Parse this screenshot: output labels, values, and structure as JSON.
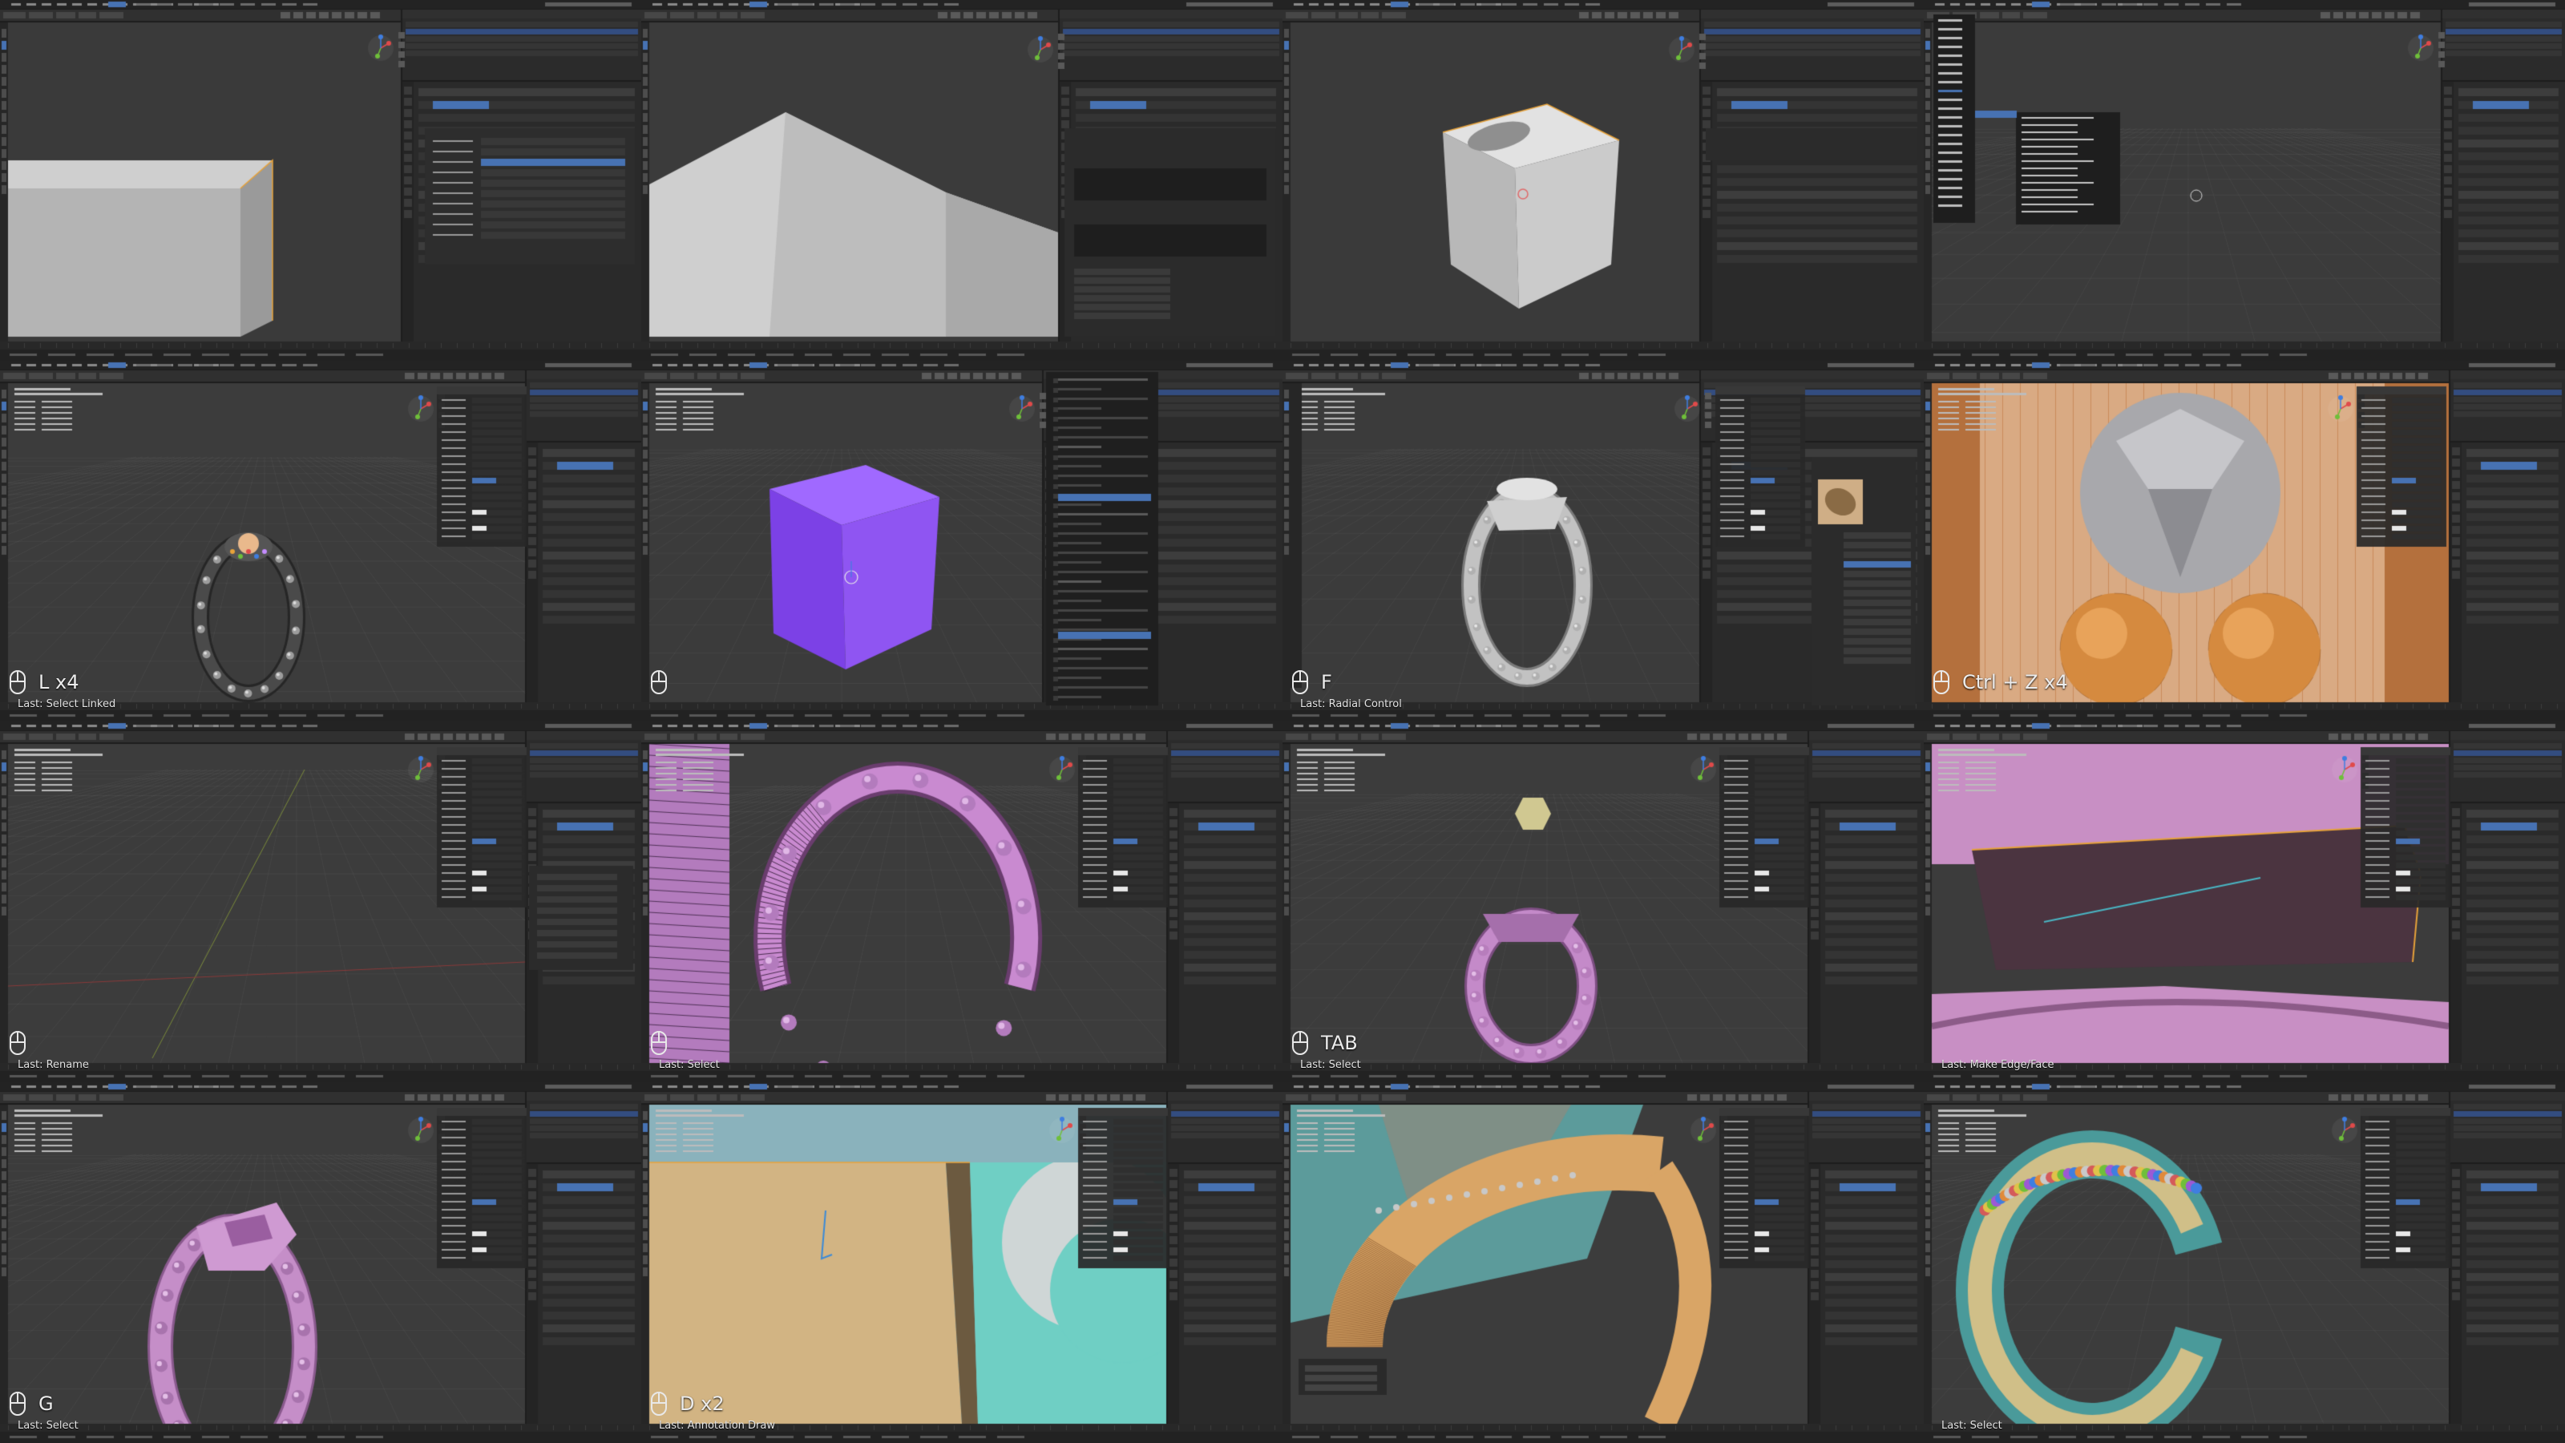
{
  "app": "Blender",
  "layout": {
    "columns": 4,
    "rows": 4
  },
  "colors": {
    "background": "#1d1d1d",
    "header": "#303030",
    "panel": "#2b2b2b",
    "viewport": "#3b3b3b",
    "accent": "#4772b3",
    "active_object": "#e8a33a",
    "tile_divider": "#171717"
  },
  "tiles": [
    {
      "id": "t1",
      "scene": "box-edge",
      "overlay": {
        "key": "",
        "last": ""
      }
    },
    {
      "id": "t2",
      "scene": "white-roof",
      "overlay": {
        "key": "",
        "last": ""
      }
    },
    {
      "id": "t3",
      "scene": "rounded-cube",
      "overlay": {
        "key": "",
        "last": ""
      }
    },
    {
      "id": "t4",
      "scene": "add-menu",
      "overlay": {
        "key": "",
        "last": ""
      }
    },
    {
      "id": "t5",
      "scene": "dark-ring",
      "overlay": {
        "key": "L x4",
        "last": "Last: Select Linked"
      }
    },
    {
      "id": "t6",
      "scene": "purple-cube",
      "overlay": {
        "key": "",
        "last": ""
      }
    },
    {
      "id": "t7",
      "scene": "grey-ring",
      "overlay": {
        "key": "F",
        "last": "Last: Radial Control"
      }
    },
    {
      "id": "t8",
      "scene": "gem-closeup",
      "overlay": {
        "key": "Ctrl + Z x4",
        "last": ""
      }
    },
    {
      "id": "t9",
      "scene": "empty-grid",
      "overlay": {
        "key": "",
        "last": "Last: Rename"
      }
    },
    {
      "id": "t10",
      "scene": "wire-ring",
      "overlay": {
        "key": "",
        "last": "Last: Select"
      }
    },
    {
      "id": "t11",
      "scene": "pink-ring-gem",
      "overlay": {
        "key": "TAB",
        "last": "Last: Select"
      }
    },
    {
      "id": "t12",
      "scene": "pink-closeup",
      "overlay": {
        "key": "",
        "last": "Last: Make Edge/Face"
      }
    },
    {
      "id": "t13",
      "scene": "pink-ring",
      "overlay": {
        "key": "G",
        "last": "Last: Select"
      }
    },
    {
      "id": "t14",
      "scene": "teal-closeup",
      "overlay": {
        "key": "D x2",
        "last": "Last: Annotation Draw"
      }
    },
    {
      "id": "t15",
      "scene": "gold-ring-closeup",
      "overlay": {
        "key": "",
        "last": ""
      }
    },
    {
      "id": "t16",
      "scene": "color-ring",
      "overlay": {
        "key": "",
        "last": "Last: Select"
      }
    }
  ]
}
